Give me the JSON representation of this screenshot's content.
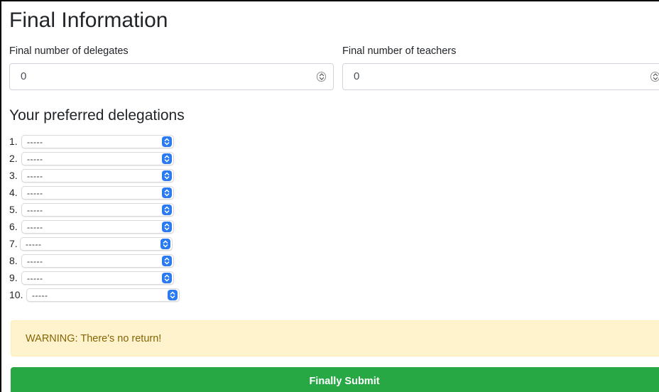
{
  "section_title": "Final Information",
  "delegates": {
    "label": "Final number of delegates",
    "value": "0"
  },
  "teachers": {
    "label": "Final number of teachers",
    "value": "0"
  },
  "preferences": {
    "title": "Your preferred delegations",
    "items": [
      {
        "number": "1.",
        "value": "-----"
      },
      {
        "number": "2.",
        "value": "-----"
      },
      {
        "number": "3.",
        "value": "-----"
      },
      {
        "number": "4.",
        "value": "-----"
      },
      {
        "number": "5.",
        "value": "-----"
      },
      {
        "number": "6.",
        "value": "-----"
      },
      {
        "number": "7.",
        "value": "-----"
      },
      {
        "number": "8.",
        "value": "-----"
      },
      {
        "number": "9.",
        "value": "-----"
      },
      {
        "number": "10.",
        "value": "-----"
      }
    ]
  },
  "warning": {
    "text": "WARNING: There's no return!"
  },
  "submit": {
    "label": "Finally Submit"
  },
  "colors": {
    "select_button": "#2b7bf0",
    "warning_bg": "#fff3cd",
    "warning_text": "#856404",
    "submit_bg": "#28a745"
  }
}
